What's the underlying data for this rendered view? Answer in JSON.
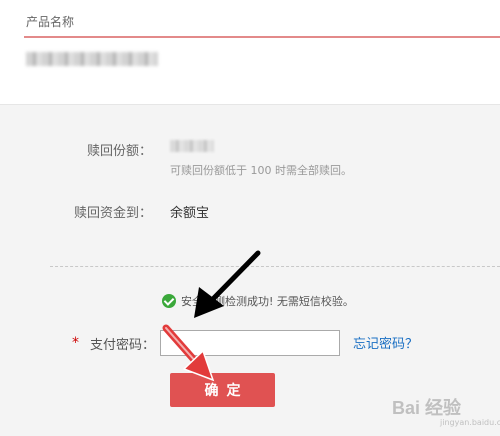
{
  "product": {
    "label": "产品名称",
    "name_blurred": true
  },
  "redeem": {
    "amount_label": "赎回份额：",
    "amount_hint": "可赎回份额低于 100 时需全部赎回。",
    "dest_label": "赎回资金到：",
    "dest_value": "余额宝"
  },
  "security": {
    "notice": "安全检测检测成功! 无需短信校验。",
    "status_color": "#3aa83a"
  },
  "payment": {
    "required_mark": "*",
    "password_label": "支付密码：",
    "password_value": "",
    "forgot_link": "忘记密码？"
  },
  "actions": {
    "confirm_label": "确定",
    "confirm_color": "#e05252"
  },
  "watermark": {
    "text": "Bai 经验",
    "subtext": "jingyan.baidu.com"
  },
  "colors": {
    "link": "#1a6fc3",
    "accent_underline": "#e38a8a",
    "required": "#cc0000"
  }
}
